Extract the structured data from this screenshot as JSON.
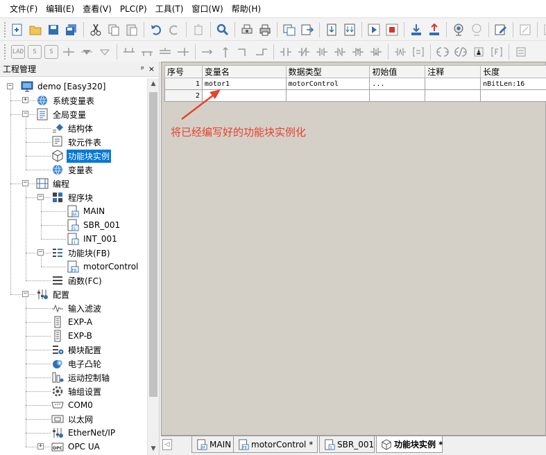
{
  "menu": [
    "文件(F)",
    "编辑(E)",
    "查看(V)",
    "PLC(P)",
    "工具(T)",
    "窗口(W)",
    "帮助(H)"
  ],
  "panel": {
    "title": "工程管理",
    "pin": "ᵖ",
    "close": "×"
  },
  "tree": [
    {
      "label": "demo [Easy320]",
      "level": 0,
      "icon": "monitor-icon",
      "expander": "−"
    },
    {
      "label": "系统变量表",
      "level": 1,
      "icon": "globe-icon",
      "expander": "+"
    },
    {
      "label": "全局变量",
      "level": 1,
      "icon": "list-doc-icon",
      "expander": "−"
    },
    {
      "label": "结构体",
      "level": 2,
      "icon": "struct-icon",
      "expander": ""
    },
    {
      "label": "软元件表",
      "level": 2,
      "icon": "doc-lines-icon",
      "expander": ""
    },
    {
      "label": "功能块实例",
      "level": 2,
      "icon": "cube-icon",
      "expander": "",
      "selected": true
    },
    {
      "label": "变量表",
      "level": 2,
      "icon": "globe-icon",
      "expander": ""
    },
    {
      "label": "编程",
      "level": 1,
      "icon": "ladder-icon",
      "expander": "−"
    },
    {
      "label": "程序块",
      "level": 2,
      "icon": "blocks-icon",
      "expander": "−"
    },
    {
      "label": "MAIN",
      "level": 3,
      "icon": "main-doc-icon",
      "expander": ""
    },
    {
      "label": "SBR_001",
      "level": 3,
      "icon": "sbr-doc-icon",
      "expander": ""
    },
    {
      "label": "INT_001",
      "level": 3,
      "icon": "int-doc-icon",
      "expander": ""
    },
    {
      "label": "功能块(FB)",
      "level": 2,
      "icon": "fb-group-icon",
      "expander": "−"
    },
    {
      "label": "motorControl",
      "level": 3,
      "icon": "fb-doc-icon",
      "expander": ""
    },
    {
      "label": "函数(FC)",
      "level": 2,
      "icon": "fc-icon",
      "expander": ""
    },
    {
      "label": "配置",
      "level": 1,
      "icon": "config-icon",
      "expander": "−"
    },
    {
      "label": "输入滤波",
      "level": 2,
      "icon": "filter-icon",
      "expander": ""
    },
    {
      "label": "EXP-A",
      "level": 2,
      "icon": "module-icon",
      "expander": ""
    },
    {
      "label": "EXP-B",
      "level": 2,
      "icon": "module-icon",
      "expander": ""
    },
    {
      "label": "模块配置",
      "level": 2,
      "icon": "module-gear-icon",
      "expander": ""
    },
    {
      "label": "电子凸轮",
      "level": 2,
      "icon": "cam-icon",
      "expander": ""
    },
    {
      "label": "运动控制轴",
      "level": 2,
      "icon": "axis-icon",
      "expander": ""
    },
    {
      "label": "轴组设置",
      "level": 2,
      "icon": "gear-icon",
      "expander": ""
    },
    {
      "label": "COM0",
      "level": 2,
      "icon": "serial-icon",
      "expander": ""
    },
    {
      "label": "以太网",
      "level": 2,
      "icon": "ethernet-icon",
      "expander": ""
    },
    {
      "label": "EtherNet/IP",
      "level": 2,
      "icon": "config-icon",
      "expander": ""
    },
    {
      "label": "OPC UA",
      "level": 2,
      "icon": "opc-icon",
      "expander": "+"
    }
  ],
  "table": {
    "headers": [
      "序号",
      "变量名",
      "数据类型",
      "初始值",
      "注释",
      "长度"
    ],
    "rows": [
      [
        "1",
        "motor1",
        "motorControl",
        "...",
        "",
        "nBitLen:16"
      ],
      [
        "2",
        "",
        "",
        "",
        "",
        ""
      ]
    ]
  },
  "annotation": "将已经编写好的功能块实例化",
  "tabs": [
    {
      "label": "MAIN",
      "icon": "main-doc-icon"
    },
    {
      "label": "motorControl *",
      "icon": "fb-doc-icon"
    },
    {
      "label": "SBR_001",
      "icon": "sbr-doc-icon"
    },
    {
      "label": "功能块实例 *",
      "icon": "cube-icon",
      "active": true
    }
  ],
  "toolbar2_glyphs": {
    "lad": "LAD",
    "s1": "S",
    "s2": "S"
  },
  "colors": {
    "selection": "#0078d7",
    "annotation": "#e8412c",
    "workspace": "#d4d0c8"
  }
}
